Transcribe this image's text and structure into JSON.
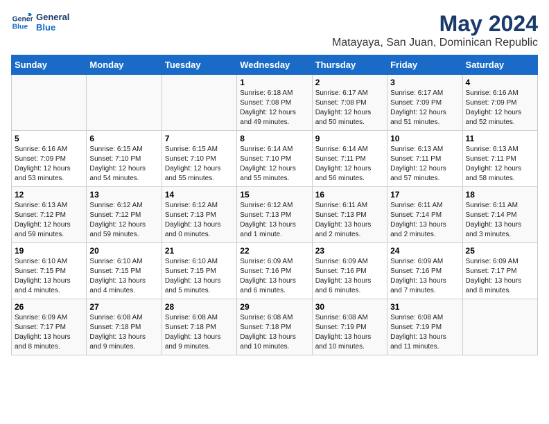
{
  "logo": {
    "line1": "General",
    "line2": "Blue"
  },
  "title": "May 2024",
  "subtitle": "Matayaya, San Juan, Dominican Republic",
  "days_header": [
    "Sunday",
    "Monday",
    "Tuesday",
    "Wednesday",
    "Thursday",
    "Friday",
    "Saturday"
  ],
  "weeks": [
    [
      {
        "day": "",
        "info": ""
      },
      {
        "day": "",
        "info": ""
      },
      {
        "day": "",
        "info": ""
      },
      {
        "day": "1",
        "info": "Sunrise: 6:18 AM\nSunset: 7:08 PM\nDaylight: 12 hours\nand 49 minutes."
      },
      {
        "day": "2",
        "info": "Sunrise: 6:17 AM\nSunset: 7:08 PM\nDaylight: 12 hours\nand 50 minutes."
      },
      {
        "day": "3",
        "info": "Sunrise: 6:17 AM\nSunset: 7:09 PM\nDaylight: 12 hours\nand 51 minutes."
      },
      {
        "day": "4",
        "info": "Sunrise: 6:16 AM\nSunset: 7:09 PM\nDaylight: 12 hours\nand 52 minutes."
      }
    ],
    [
      {
        "day": "5",
        "info": "Sunrise: 6:16 AM\nSunset: 7:09 PM\nDaylight: 12 hours\nand 53 minutes."
      },
      {
        "day": "6",
        "info": "Sunrise: 6:15 AM\nSunset: 7:10 PM\nDaylight: 12 hours\nand 54 minutes."
      },
      {
        "day": "7",
        "info": "Sunrise: 6:15 AM\nSunset: 7:10 PM\nDaylight: 12 hours\nand 55 minutes."
      },
      {
        "day": "8",
        "info": "Sunrise: 6:14 AM\nSunset: 7:10 PM\nDaylight: 12 hours\nand 55 minutes."
      },
      {
        "day": "9",
        "info": "Sunrise: 6:14 AM\nSunset: 7:11 PM\nDaylight: 12 hours\nand 56 minutes."
      },
      {
        "day": "10",
        "info": "Sunrise: 6:13 AM\nSunset: 7:11 PM\nDaylight: 12 hours\nand 57 minutes."
      },
      {
        "day": "11",
        "info": "Sunrise: 6:13 AM\nSunset: 7:11 PM\nDaylight: 12 hours\nand 58 minutes."
      }
    ],
    [
      {
        "day": "12",
        "info": "Sunrise: 6:13 AM\nSunset: 7:12 PM\nDaylight: 12 hours\nand 59 minutes."
      },
      {
        "day": "13",
        "info": "Sunrise: 6:12 AM\nSunset: 7:12 PM\nDaylight: 12 hours\nand 59 minutes."
      },
      {
        "day": "14",
        "info": "Sunrise: 6:12 AM\nSunset: 7:13 PM\nDaylight: 13 hours\nand 0 minutes."
      },
      {
        "day": "15",
        "info": "Sunrise: 6:12 AM\nSunset: 7:13 PM\nDaylight: 13 hours\nand 1 minute."
      },
      {
        "day": "16",
        "info": "Sunrise: 6:11 AM\nSunset: 7:13 PM\nDaylight: 13 hours\nand 2 minutes."
      },
      {
        "day": "17",
        "info": "Sunrise: 6:11 AM\nSunset: 7:14 PM\nDaylight: 13 hours\nand 2 minutes."
      },
      {
        "day": "18",
        "info": "Sunrise: 6:11 AM\nSunset: 7:14 PM\nDaylight: 13 hours\nand 3 minutes."
      }
    ],
    [
      {
        "day": "19",
        "info": "Sunrise: 6:10 AM\nSunset: 7:15 PM\nDaylight: 13 hours\nand 4 minutes."
      },
      {
        "day": "20",
        "info": "Sunrise: 6:10 AM\nSunset: 7:15 PM\nDaylight: 13 hours\nand 4 minutes."
      },
      {
        "day": "21",
        "info": "Sunrise: 6:10 AM\nSunset: 7:15 PM\nDaylight: 13 hours\nand 5 minutes."
      },
      {
        "day": "22",
        "info": "Sunrise: 6:09 AM\nSunset: 7:16 PM\nDaylight: 13 hours\nand 6 minutes."
      },
      {
        "day": "23",
        "info": "Sunrise: 6:09 AM\nSunset: 7:16 PM\nDaylight: 13 hours\nand 6 minutes."
      },
      {
        "day": "24",
        "info": "Sunrise: 6:09 AM\nSunset: 7:16 PM\nDaylight: 13 hours\nand 7 minutes."
      },
      {
        "day": "25",
        "info": "Sunrise: 6:09 AM\nSunset: 7:17 PM\nDaylight: 13 hours\nand 8 minutes."
      }
    ],
    [
      {
        "day": "26",
        "info": "Sunrise: 6:09 AM\nSunset: 7:17 PM\nDaylight: 13 hours\nand 8 minutes."
      },
      {
        "day": "27",
        "info": "Sunrise: 6:08 AM\nSunset: 7:18 PM\nDaylight: 13 hours\nand 9 minutes."
      },
      {
        "day": "28",
        "info": "Sunrise: 6:08 AM\nSunset: 7:18 PM\nDaylight: 13 hours\nand 9 minutes."
      },
      {
        "day": "29",
        "info": "Sunrise: 6:08 AM\nSunset: 7:18 PM\nDaylight: 13 hours\nand 10 minutes."
      },
      {
        "day": "30",
        "info": "Sunrise: 6:08 AM\nSunset: 7:19 PM\nDaylight: 13 hours\nand 10 minutes."
      },
      {
        "day": "31",
        "info": "Sunrise: 6:08 AM\nSunset: 7:19 PM\nDaylight: 13 hours\nand 11 minutes."
      },
      {
        "day": "",
        "info": ""
      }
    ]
  ]
}
